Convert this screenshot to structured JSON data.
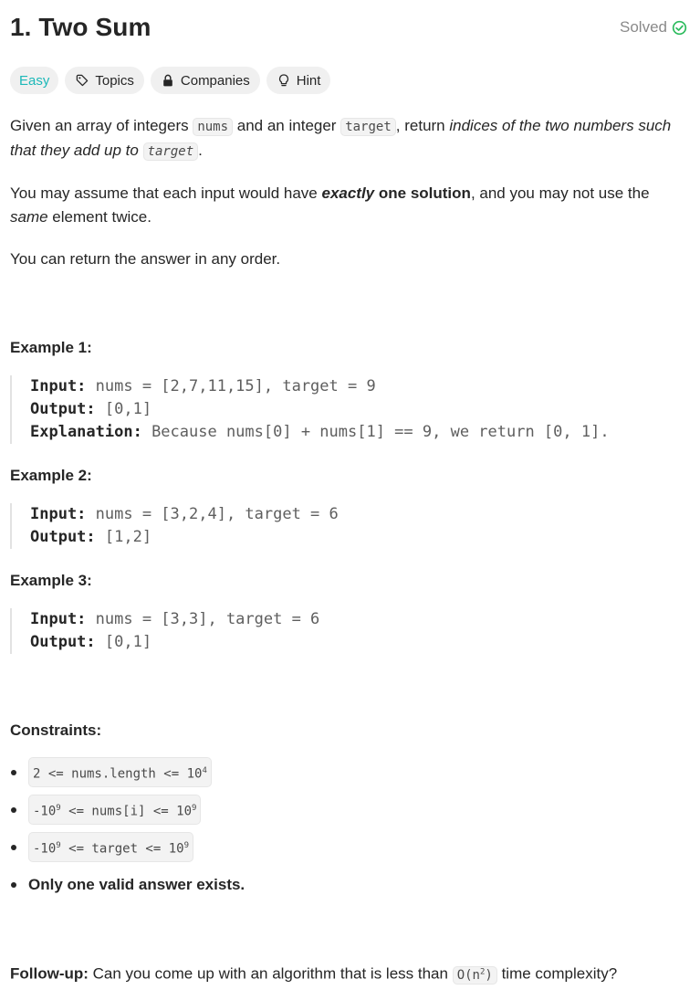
{
  "problem": {
    "title": "1. Two Sum",
    "status": "Solved"
  },
  "chips": {
    "difficulty": "Easy",
    "topics": "Topics",
    "companies": "Companies",
    "hint": "Hint"
  },
  "desc": {
    "p1_a": "Given an array of integers ",
    "p1_code1": "nums",
    "p1_b": " and an integer ",
    "p1_code2": "target",
    "p1_c": ", return ",
    "p1_em": "indices of the two numbers such that they add up to",
    "p1_code3": "target",
    "p1_d": ".",
    "p2_a": "You may assume that each input would have ",
    "p2_strong_em": "exactly",
    "p2_strong": " one solution",
    "p2_b": ", and you may not use the ",
    "p2_em": "same",
    "p2_c": " element twice.",
    "p3": "You can return the answer in any order."
  },
  "labels": {
    "input": "Input:",
    "output": "Output:",
    "explanation": "Explanation:"
  },
  "examples": [
    {
      "title": "Example 1:",
      "input": " nums = [2,7,11,15], target = 9",
      "output": " [0,1]",
      "explanation": " Because nums[0] + nums[1] == 9, we return [0, 1]."
    },
    {
      "title": "Example 2:",
      "input": " nums = [3,2,4], target = 6",
      "output": " [1,2]"
    },
    {
      "title": "Example 3:",
      "input": " nums = [3,3], target = 6",
      "output": " [0,1]"
    }
  ],
  "constraints": {
    "title": "Constraints:",
    "c1_a": "2 <= nums.length <= 10",
    "c1_sup": "4",
    "c2_a": "-10",
    "c2_sup1": "9",
    "c2_b": " <= nums[i] <= 10",
    "c2_sup2": "9",
    "c3_a": "-10",
    "c3_sup1": "9",
    "c3_b": " <= target <= 10",
    "c3_sup2": "9",
    "c4": "Only one valid answer exists."
  },
  "followup": {
    "label": "Follow-up:",
    "text_a": " Can you come up with an algorithm that is less than ",
    "code_a": "O(n",
    "code_sup": "2",
    "code_b": ")",
    "text_b": " time complexity?"
  },
  "colors": {
    "easy": "#1cb8b8",
    "solved": "#2cbb5d",
    "text": "#262626"
  },
  "icons": [
    "check-circle-icon",
    "tag-icon",
    "lock-icon",
    "lightbulb-icon"
  ]
}
